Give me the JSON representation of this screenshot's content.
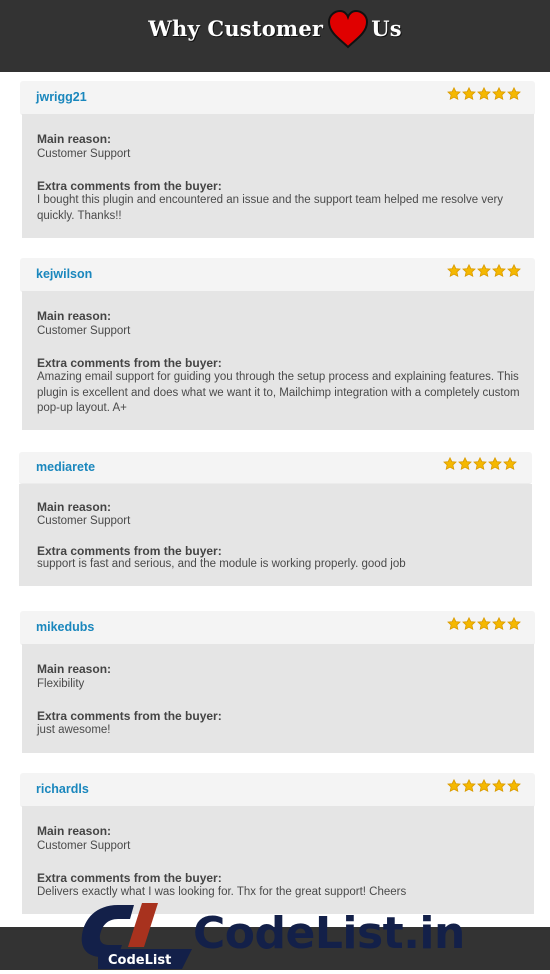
{
  "header": {
    "title_before": "Why Customer",
    "title_icon": "heart-icon",
    "title_after": "Us"
  },
  "labels": {
    "main_reason": "Main reason:",
    "extra_comments": "Extra comments from the buyer:"
  },
  "reviews": [
    {
      "username": "jwrigg21",
      "rating": 5,
      "max_rating": 5,
      "main_reason": "Customer Support",
      "comment": "I bought this plugin and encountered an issue and the support team helped me resolve very quickly. Thanks!!"
    },
    {
      "username": "kejwilson",
      "rating": 5,
      "max_rating": 5,
      "main_reason": "Customer Support",
      "comment": "Amazing email support for guiding you through the setup process and explaining features. This plugin is excellent and does what we want it to, Mailchimp integration with a completely custom pop-up layout. A+"
    },
    {
      "username": "mediarete",
      "rating": 5,
      "max_rating": 5,
      "main_reason": "Customer Support",
      "comment": "support is fast and serious, and the module is working properly. good job"
    },
    {
      "username": "mikedubs",
      "rating": 5,
      "max_rating": 5,
      "main_reason": "Flexibility",
      "comment": "just awesome!"
    },
    {
      "username": "richardls",
      "rating": 5,
      "max_rating": 5,
      "main_reason": "Customer Support",
      "comment": "Delivers exactly what I was looking for. Thx for the great support! Cheers"
    }
  ],
  "footer": {
    "logo_badge_text": "CodeList",
    "logo_wordmark": "CodeList.in"
  },
  "colors": {
    "username": "#1a87bd",
    "star": "#f5b800",
    "heart": "#e00000",
    "bar": "#333333",
    "logo_navy": "#132049",
    "logo_red": "#a8321e"
  }
}
